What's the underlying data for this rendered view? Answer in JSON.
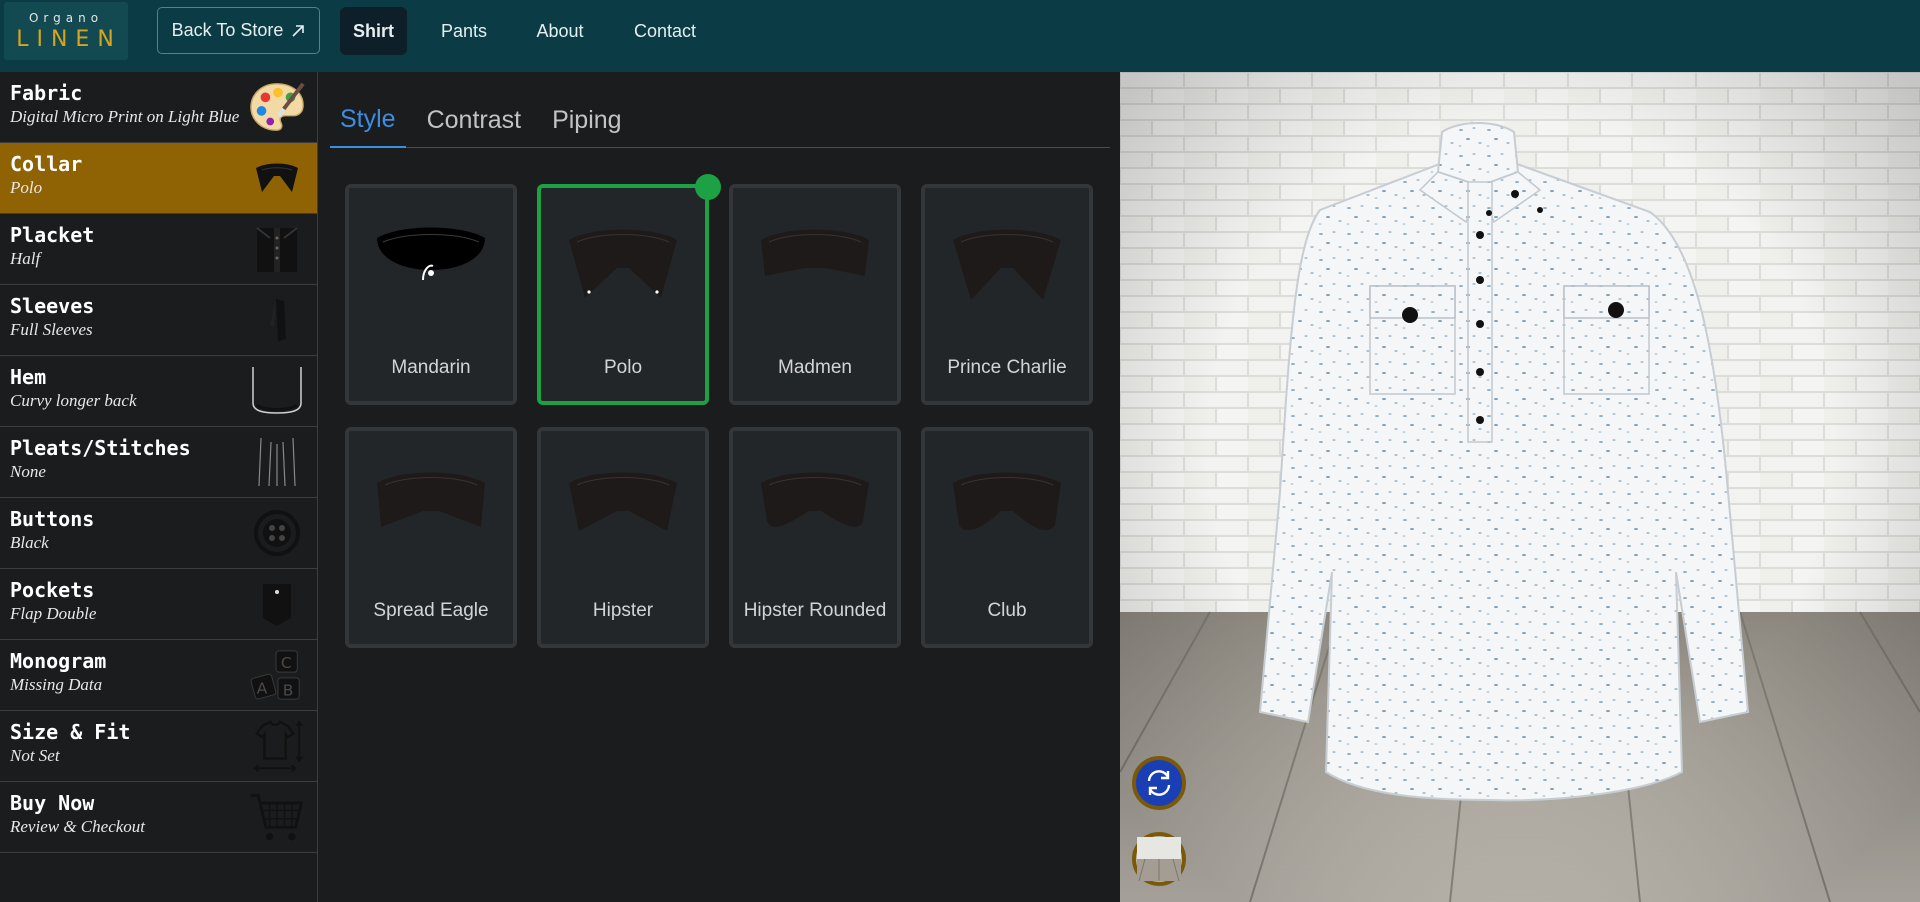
{
  "brand": {
    "line1": "Organo",
    "line2": "LINEN"
  },
  "header": {
    "back_label": "Back To Store",
    "nav": [
      {
        "label": "Shirt",
        "active": true
      },
      {
        "label": "Pants",
        "active": false
      },
      {
        "label": "About",
        "active": false
      },
      {
        "label": "Contact",
        "active": false
      }
    ]
  },
  "sidebar": {
    "items": [
      {
        "name": "Fabric",
        "value": "Digital Micro Print on Light Blue",
        "icon": "palette-icon"
      },
      {
        "name": "Collar",
        "value": "Polo",
        "icon": "collar-icon",
        "selected": true
      },
      {
        "name": "Placket",
        "value": "Half",
        "icon": "placket-icon"
      },
      {
        "name": "Sleeves",
        "value": "Full Sleeves",
        "icon": "sleeve-icon"
      },
      {
        "name": "Hem",
        "value": "Curvy longer back",
        "icon": "hem-icon"
      },
      {
        "name": "Pleats/Stitches",
        "value": "None",
        "icon": "pleats-icon"
      },
      {
        "name": "Buttons",
        "value": "Black",
        "icon": "button-icon"
      },
      {
        "name": "Pockets",
        "value": "Flap Double",
        "icon": "pocket-icon"
      },
      {
        "name": "Monogram",
        "value": "Missing Data",
        "icon": "monogram-blocks-icon"
      },
      {
        "name": "Size & Fit",
        "value": "Not Set",
        "icon": "size-fit-icon"
      },
      {
        "name": "Buy Now",
        "value": "Review & Checkout",
        "icon": "cart-icon"
      }
    ]
  },
  "panel": {
    "tabs": [
      {
        "label": "Style",
        "active": true
      },
      {
        "label": "Contrast",
        "active": false
      },
      {
        "label": "Piping",
        "active": false
      }
    ],
    "options": [
      {
        "label": "Mandarin",
        "selected": false
      },
      {
        "label": "Polo",
        "selected": true
      },
      {
        "label": "Madmen",
        "selected": false
      },
      {
        "label": "Prince Charlie",
        "selected": false
      },
      {
        "label": "Spread Eagle",
        "selected": false
      },
      {
        "label": "Hipster",
        "selected": false
      },
      {
        "label": "Hipster Rounded",
        "selected": false
      },
      {
        "label": "Club",
        "selected": false
      }
    ]
  },
  "viewer": {
    "controls": [
      "rotate-icon",
      "background-swatch-icon"
    ]
  },
  "colors": {
    "topbar": "#0b3c45",
    "accent": "#3d8de0",
    "selected_item": "#8f6303",
    "selected_card": "#1da145",
    "brand_gold": "#d6a520"
  }
}
